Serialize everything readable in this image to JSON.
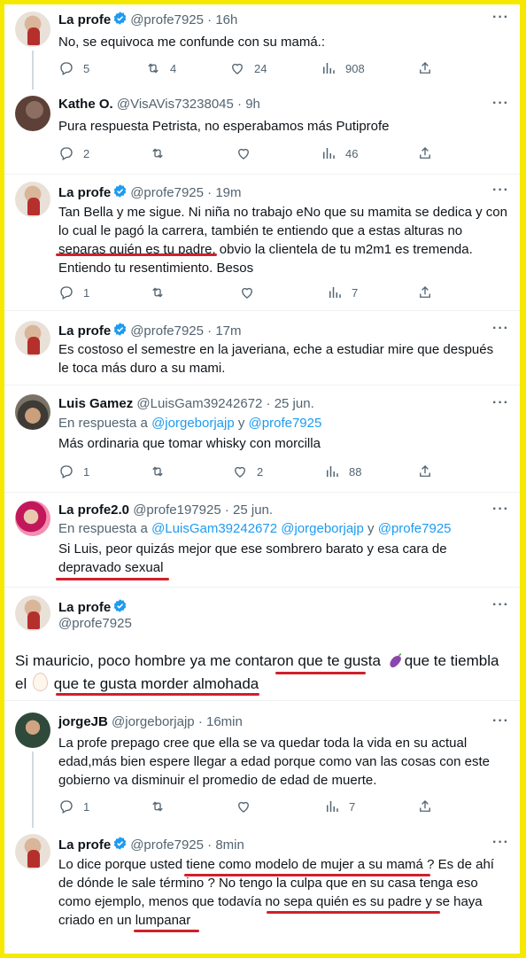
{
  "colors": {
    "accent": "#1d9bf0",
    "verified": "#1d9bf0",
    "text": "#0f1419",
    "muted": "#536471",
    "frame": "#f5e900",
    "underline": "#d0202a"
  },
  "tweets": [
    {
      "name": "La profe",
      "handle": "@profe7925",
      "time": "· 16h",
      "verified": true,
      "text": "No, se equivoca me confunde con su mamá.:",
      "replies": "5",
      "retweets": "4",
      "likes": "24",
      "views": "908"
    },
    {
      "name": "Kathe O.",
      "handle": "@VisAVis73238045",
      "time": "· 9h",
      "verified": false,
      "text": "Pura respuesta Petrista, no esperabamos más Putiprofe",
      "replies": "2",
      "retweets": "",
      "likes": "",
      "views": "46"
    },
    {
      "name": "La profe",
      "handle": "@profe7925",
      "time": "· 19m",
      "verified": true,
      "line1": "Tan Bella y me sigue. Ni niña no trabajo eNo que su mamita se dedica y con",
      "line2": "lo cual le  pagó la carrera, también te entiendo que a estas alturas no",
      "line3": "separas quién es tu padre, obvio la clientela de tu m2m1 es tremenda.",
      "line4": "Entiendo tu resentimiento. Besos",
      "replies": "1",
      "retweets": "",
      "likes": "",
      "views": "7"
    },
    {
      "name": "La profe",
      "handle": "@profe7925",
      "time": "· 17m",
      "verified": true,
      "line1": "Es costoso el semestre en la  javeriana, eche a estudiar mire que después",
      "line2": "le toca más duro a su mami."
    },
    {
      "name": "Luis Gamez",
      "handle": "@LuisGam39242672",
      "time": "· 25 jun.",
      "verified": false,
      "reply_prefix": "En respuesta a",
      "reply_user1": "@jorgeborjajp",
      "reply_and": "y",
      "reply_user2": "@profe7925",
      "text": "Más ordinaria que tomar whisky con morcilla",
      "replies": "1",
      "retweets": "",
      "likes": "2",
      "views": "88"
    },
    {
      "name": "La profe2.0",
      "handle": "@profe197925",
      "time": "· 25 jun.",
      "verified": false,
      "reply_prefix": "En respuesta a",
      "reply_user1": "@LuisGam39242672",
      "reply_user2": "@jorgeborjajp",
      "reply_and": "y",
      "reply_user3": "@profe7925",
      "line1": "Si Luis, peor quizás mejor que ese sombrero barato y esa cara de",
      "line2": "depravado sexual"
    },
    {
      "name": "La profe",
      "handle": "@profe7925",
      "verified": true,
      "line1a": "Si mauricio, poco hombre ya me contaron que te gusta",
      "line1b": "que te tiembla",
      "line2a": "el",
      "line2b": "que te gusta morder almohada"
    },
    {
      "name": "jorgeJB",
      "handle": "@jorgeborjajp",
      "time": "· 16min",
      "verified": false,
      "line1": "La profe prepago cree que ella se va quedar toda la vida en su actual",
      "line2": "edad,más bien espere llegar a edad porque como van las cosas con este",
      "line3": "gobierno va disminuir el promedio de edad de muerte.",
      "replies": "1",
      "retweets": "",
      "likes": "",
      "views": "7"
    },
    {
      "name": "La profe",
      "handle": "@profe7925",
      "time": "· 8min",
      "verified": true,
      "line1": "Lo dice porque usted tiene como modelo de mujer a su mamá ? Es de ahí",
      "line2": "de dónde  le sale término ? No tengo la culpa que en su casa tenga eso",
      "line3": "como ejemplo, menos que todavía no sepa quién es su  padre y se haya",
      "line4": "criado en un lumpanar"
    }
  ],
  "more_icon": "···"
}
